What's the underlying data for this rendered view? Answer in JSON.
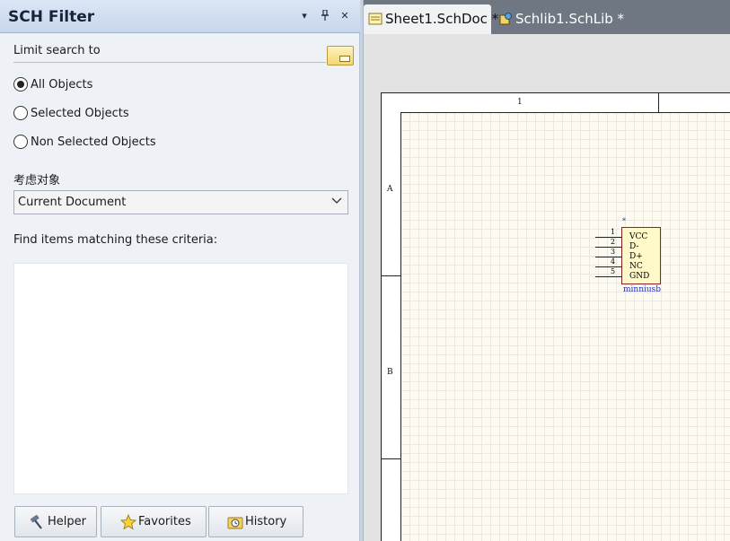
{
  "panel": {
    "title": "SCH Filter",
    "controls": {
      "menu": "▾",
      "pin": "📌",
      "close": "✕"
    },
    "limit_label": "Limit search to",
    "radio_options": [
      {
        "label": "All Objects",
        "checked": true
      },
      {
        "label": "Selected Objects",
        "checked": false
      },
      {
        "label": "Non Selected Objects",
        "checked": false
      }
    ],
    "scope_label": "考虑对象",
    "scope_value": "Current Document",
    "criteria_label": "Find items matching these criteria:",
    "criteria_text": "",
    "buttons": [
      {
        "label": "Helper",
        "icon": "hammer-icon"
      },
      {
        "label": "Favorites",
        "icon": "star-icon"
      },
      {
        "label": "History",
        "icon": "history-folder-icon"
      }
    ]
  },
  "tabs": [
    {
      "label": "Sheet1.SchDoc *",
      "active": true,
      "icon": "schematic-doc-icon"
    },
    {
      "label": "Schlib1.SchLib *",
      "active": false,
      "icon": "schematic-lib-icon"
    }
  ],
  "sheet": {
    "column_labels": [
      "1"
    ],
    "row_labels": [
      "A",
      "B"
    ],
    "component": {
      "designator": "*",
      "name": "minniusb",
      "pins": [
        {
          "num": "1",
          "name": "VCC"
        },
        {
          "num": "2",
          "name": "D-"
        },
        {
          "num": "3",
          "name": "D+"
        },
        {
          "num": "4",
          "name": "NC"
        },
        {
          "num": "5",
          "name": "GND"
        }
      ]
    }
  },
  "colors": {
    "panel_bg": "#eef1f6",
    "tabbar_bg": "#6f7782",
    "sheet_bg": "#fdfaf2",
    "component_fill": "#fff8c8",
    "component_border": "#8a2222",
    "designator_blue": "#1c2fb8"
  }
}
